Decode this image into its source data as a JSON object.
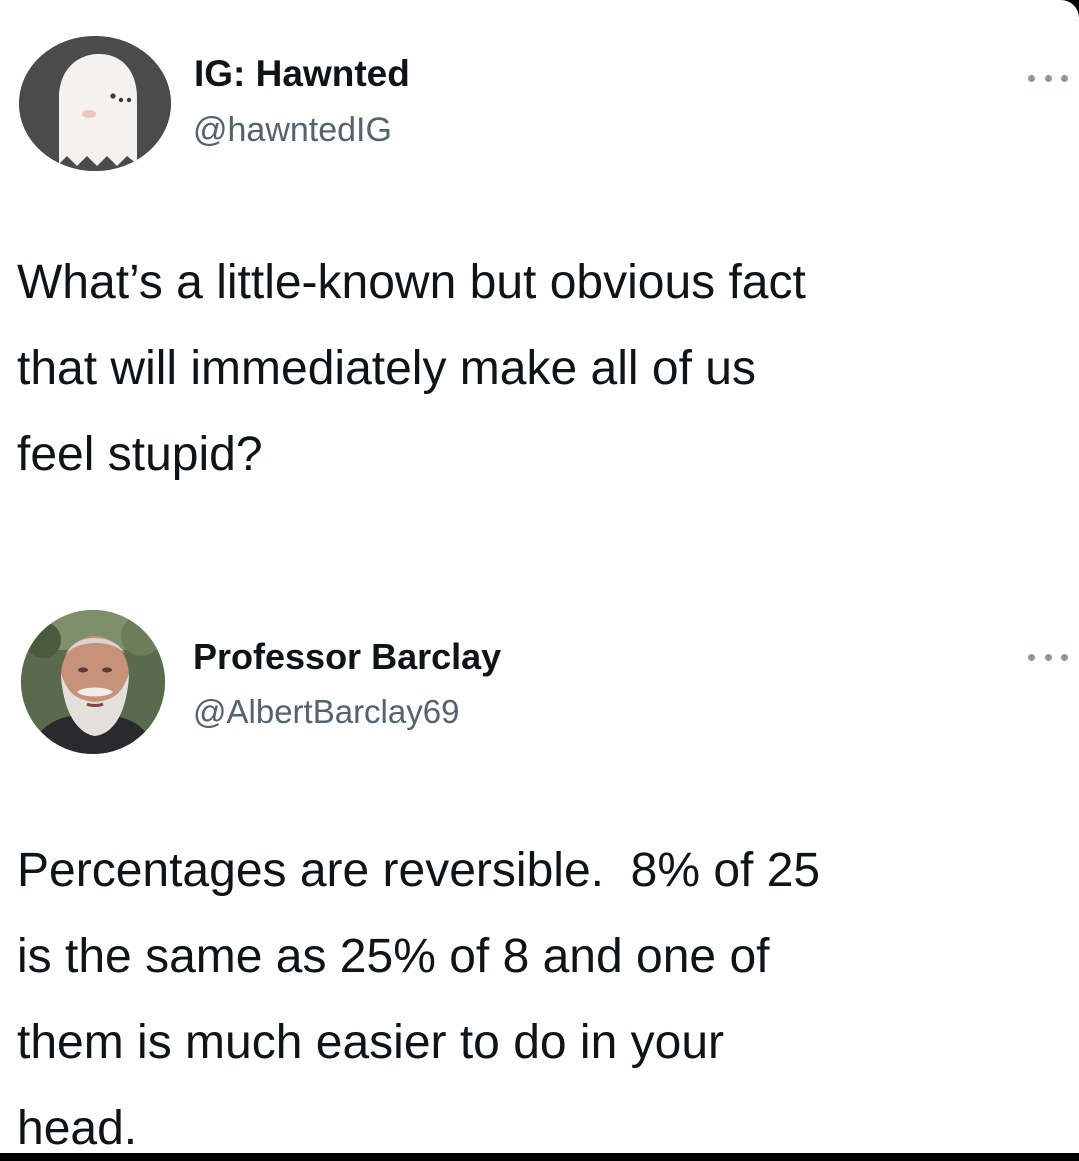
{
  "tweets": [
    {
      "display_name": "IG: Hawnted",
      "handle": "@hawntedIG",
      "avatar_icon": "ghost-avatar",
      "more_icon": "ellipsis-icon",
      "text": "What’s a little-known but obvious fact\nthat will immediately make all of us\nfeel stupid?"
    },
    {
      "display_name": "Professor Barclay",
      "handle": "@AlbertBarclay69",
      "avatar_icon": "bearded-man-avatar",
      "more_icon": "ellipsis-icon",
      "text": "Percentages are reversible.  8% of 25\nis the same as 25% of 8 and one of\nthem is much easier to do in your\nhead."
    }
  ],
  "colors": {
    "text_primary": "#0f1419",
    "text_secondary": "#536471",
    "background": "#ffffff",
    "frame": "#000000"
  }
}
